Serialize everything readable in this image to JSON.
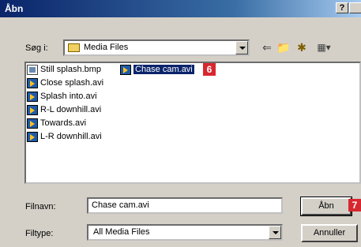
{
  "dialog": {
    "title": "Åbn",
    "help_label": "?",
    "close_label": "×"
  },
  "lookin": {
    "label": "Søg i:",
    "value": "Media Files",
    "icon": "folder-icon"
  },
  "toolbar": {
    "back_icon": "back-arrow-icon",
    "up_icon": "up-folder-icon",
    "new_folder_icon": "new-folder-icon",
    "view_icon": "view-menu-icon"
  },
  "files": [
    {
      "name": "Still splash.bmp",
      "type": "bmp"
    },
    {
      "name": "Close splash.avi",
      "type": "avi"
    },
    {
      "name": "Splash into.avi",
      "type": "avi"
    },
    {
      "name": "R-L downhill.avi",
      "type": "avi"
    },
    {
      "name": "Towards.avi",
      "type": "avi"
    },
    {
      "name": "L-R downhill.avi",
      "type": "avi"
    },
    {
      "name": "Chase cam.avi",
      "type": "avi",
      "selected": true
    }
  ],
  "callouts": {
    "selection": "6",
    "open": "7"
  },
  "filename": {
    "label": "Filnavn:",
    "value": "Chase cam.avi"
  },
  "filetype": {
    "label": "Filtype:",
    "value": "All Media Files"
  },
  "buttons": {
    "open": "Åbn",
    "cancel": "Annuller"
  }
}
